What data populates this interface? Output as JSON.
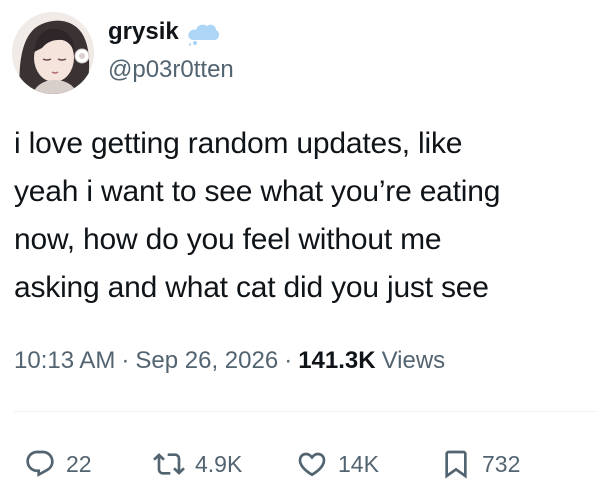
{
  "user": {
    "display_name": "grysik",
    "handle": "@p03r0tten",
    "avatar_icon": "avatar-illustration",
    "badge_icon": "cloud-icon",
    "badge_color": "#a9d4f5"
  },
  "tweet": {
    "text": "i love getting random updates, like\nyeah i want to see what you’re eating\nnow, how do you feel without me\nasking and what cat did you just see",
    "time": "10:13 AM",
    "date": "Sep 26, 2026",
    "separator": "·",
    "views_count": "141.3K",
    "views_label": "Views"
  },
  "actions": {
    "reply_count": "22",
    "repost_count": "4.9K",
    "like_count": "14K",
    "bookmark_count": "732",
    "reply_icon": "reply-icon",
    "repost_icon": "repost-icon",
    "like_icon": "heart-icon",
    "bookmark_icon": "bookmark-icon"
  },
  "colors": {
    "text_primary": "#0f1419",
    "text_secondary": "#536471",
    "divider": "#eff3f4"
  }
}
